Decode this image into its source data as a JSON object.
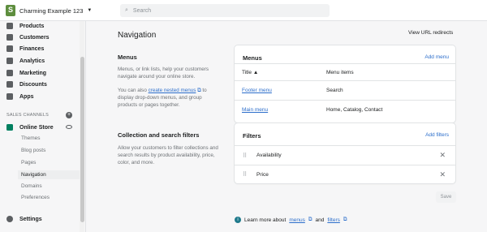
{
  "topbar": {
    "store_name": "Charming Example 123",
    "search_placeholder": "Search"
  },
  "sidebar": {
    "items": [
      {
        "label": "Products",
        "icon": "tag-icon"
      },
      {
        "label": "Customers",
        "icon": "person-icon"
      },
      {
        "label": "Finances",
        "icon": "bank-icon"
      },
      {
        "label": "Analytics",
        "icon": "bar-chart-icon"
      },
      {
        "label": "Marketing",
        "icon": "megaphone-icon"
      },
      {
        "label": "Discounts",
        "icon": "discount-icon"
      },
      {
        "label": "Apps",
        "icon": "apps-icon"
      }
    ],
    "channels_label": "SALES CHANNELS",
    "online_store": "Online Store",
    "sub_items": [
      "Themes",
      "Blog posts",
      "Pages",
      "Navigation",
      "Domains",
      "Preferences"
    ],
    "settings": "Settings"
  },
  "main": {
    "title": "Navigation",
    "view_redirects": "View URL redirects",
    "menus_section": {
      "title": "Menus",
      "desc1": "Menus, or link lists, help your customers navigate around your online store.",
      "desc2_pre": "You can also ",
      "desc2_link": "create nested menus",
      "desc2_post": " to display drop-down menus, and group products or pages together."
    },
    "menus_card": {
      "title": "Menus",
      "action": "Add menu",
      "col_title": "Title ▲",
      "col_items": "Menu items",
      "rows": [
        {
          "title": "Footer menu",
          "items": "Search"
        },
        {
          "title": "Main menu",
          "items": "Home, Catalog, Contact"
        }
      ]
    },
    "filters_section": {
      "title": "Collection and search filters",
      "desc": "Allow your customers to filter collections and search results by product availability, price, color, and more."
    },
    "filters_card": {
      "title": "Filters",
      "action": "Add filters",
      "rows": [
        "Availability",
        "Price"
      ]
    },
    "save": "Save",
    "learn": {
      "pre": "Learn more about ",
      "link1": "menus",
      "mid": " and ",
      "link2": "filters"
    }
  },
  "colors": {
    "accent": "#2c6ecb",
    "brand": "#5e8e3e"
  }
}
